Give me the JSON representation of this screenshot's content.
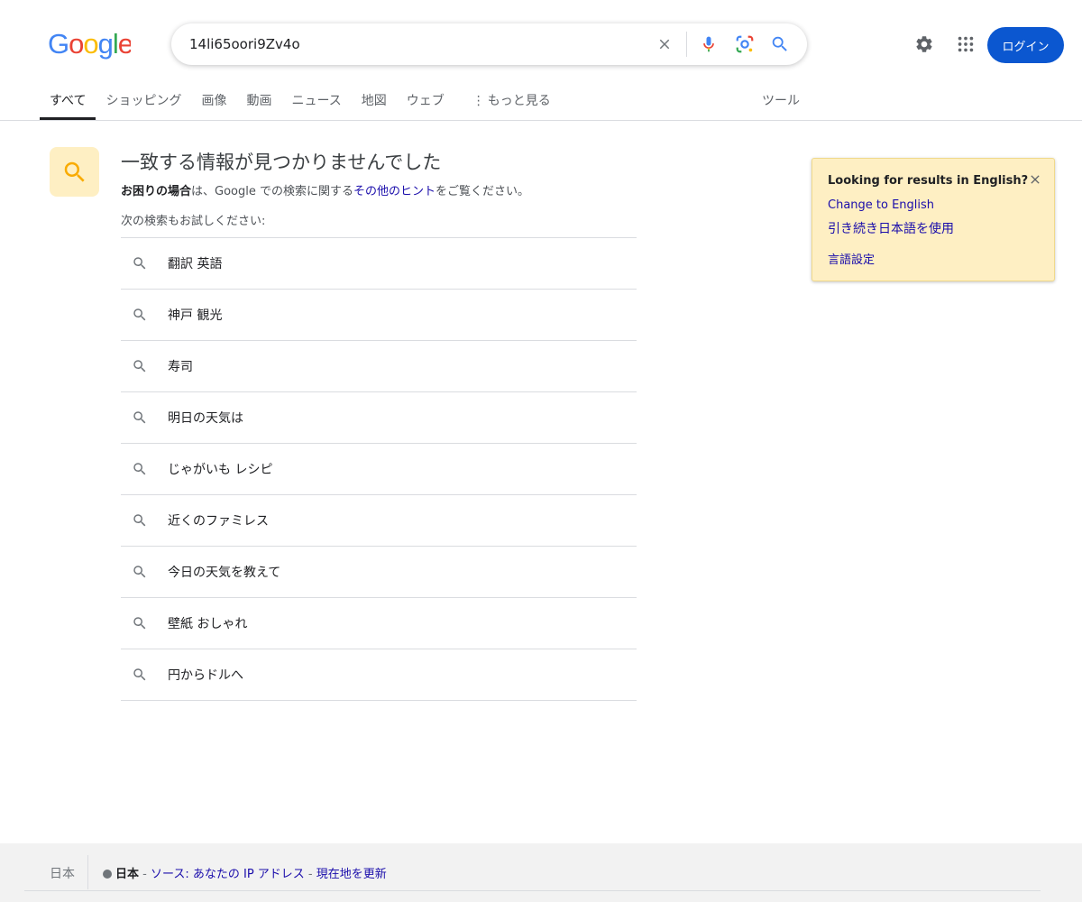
{
  "header": {
    "logo_text": "Google",
    "search_value": "14li65oori9Zv4o",
    "login_label": "ログイン"
  },
  "tabs": [
    {
      "label": "すべて",
      "active": true
    },
    {
      "label": "ショッピング"
    },
    {
      "label": "画像"
    },
    {
      "label": "動画"
    },
    {
      "label": "ニュース"
    },
    {
      "label": "地図"
    },
    {
      "label": "ウェブ"
    },
    {
      "label": "もっと見る"
    }
  ],
  "tools_label": "ツール",
  "no_results": {
    "title": "一致する情報が見つかりませんでした",
    "hint_bold": "お困りの場合",
    "hint_pre": "は、Google での検索に関する",
    "hint_link": "その他のヒント",
    "hint_post": "をご覧ください。",
    "try_label": "次の検索もお試しください:"
  },
  "suggestions": [
    "翻訳 英語",
    "神戸 観光",
    "寿司",
    "明日の天気は",
    "じゃがいも レシピ",
    "近くのファミレス",
    "今日の天気を教えて",
    "壁紙 おしゃれ",
    "円からドルへ"
  ],
  "lang_card": {
    "title": "Looking for results in English?",
    "change_link": "Change to English",
    "keep_link": "引き続き日本語を使用",
    "settings_link": "言語設定"
  },
  "footer": {
    "country": "日本",
    "location_bold": "日本",
    "sep1": " - ",
    "source_link": "ソース: あなたの IP アドレス",
    "sep2": " - ",
    "update_link": "現在地を更新"
  },
  "colors": {
    "brand_blue": "#0b57d0",
    "link": "#1a0dab",
    "card_bg": "#feefc3",
    "icon_yellow": "#f9ab00"
  },
  "icons": {
    "clear": "close-icon",
    "mic": "mic-icon",
    "lens": "lens-icon",
    "search": "search-icon",
    "settings": "gear-icon",
    "apps": "apps-grid-icon"
  }
}
